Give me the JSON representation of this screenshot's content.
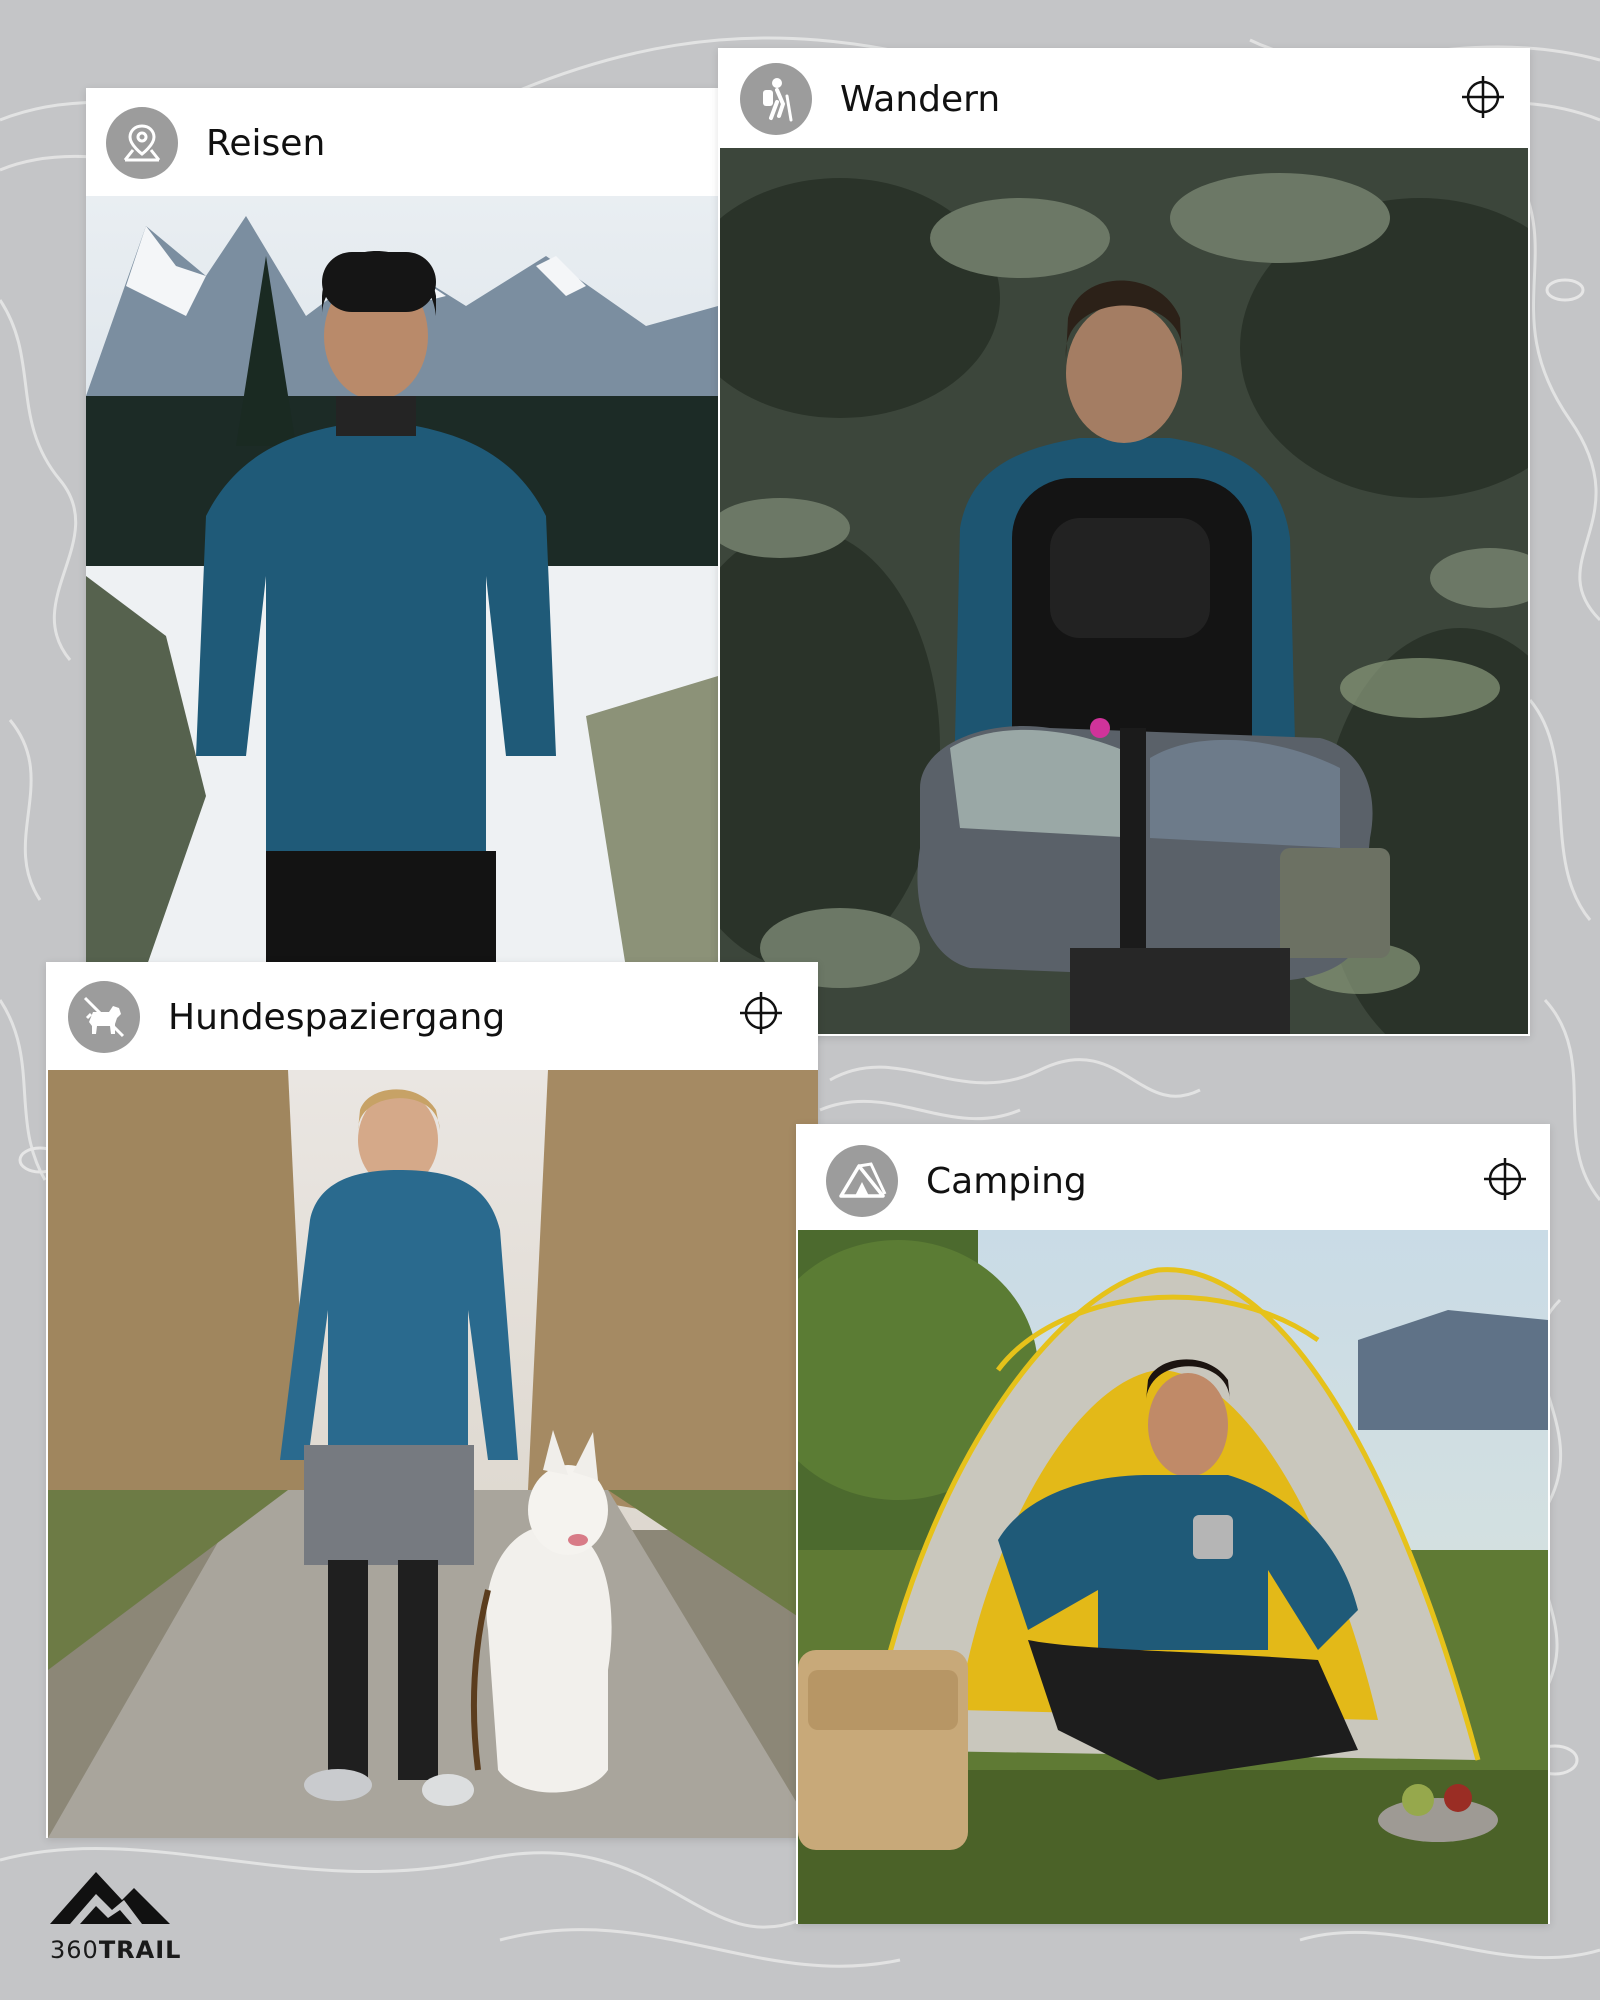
{
  "cards": {
    "travel": {
      "title": "Reisen",
      "icon": "location-pin-icon"
    },
    "hiking": {
      "title": "Wandern",
      "icon": "hiker-icon"
    },
    "dogwalk": {
      "title": "Hundespaziergang",
      "icon": "dog-icon"
    },
    "camping": {
      "title": "Camping",
      "icon": "tent-icon"
    }
  },
  "brand": {
    "prefix": "360",
    "suffix": "TRAIL"
  },
  "colors": {
    "background": "#c4c5c7",
    "badge": "#9c9c9c",
    "jacket_blue": "#1f5a78"
  }
}
